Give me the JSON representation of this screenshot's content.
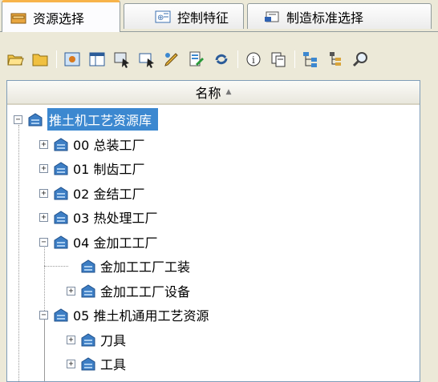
{
  "tabs": [
    {
      "label": "资源选择",
      "active": true
    },
    {
      "label": "控制特征",
      "active": false
    },
    {
      "label": "制造标准选择",
      "active": false
    }
  ],
  "toolbar": {
    "icons": [
      "open-folder-icon",
      "folder-icon",
      "image-icon",
      "window-icon",
      "zoom-select-icon",
      "select-cursor-icon",
      "edit-icon",
      "tree-edit-icon",
      "refresh-icon",
      "info-icon",
      "copy-icon",
      "hierarchy-icon",
      "tree-icon",
      "search-icon"
    ]
  },
  "tree": {
    "column_header": "名称",
    "sort_indicator": "▲",
    "nodes": [
      {
        "label": "推土机工艺资源库",
        "selected": true
      },
      {
        "label": "00 总装工厂"
      },
      {
        "label": "01 制齿工厂"
      },
      {
        "label": "02 金结工厂"
      },
      {
        "label": "03 热处理工厂"
      },
      {
        "label": "04 金加工工厂"
      },
      {
        "label": "金加工工厂工装"
      },
      {
        "label": "金加工工厂设备"
      },
      {
        "label": "05 推土机通用工艺资源"
      },
      {
        "label": "刀具"
      },
      {
        "label": "工具"
      }
    ]
  },
  "colors": {
    "selection": "#3c88d0",
    "node_icon": "#3d7ec4",
    "tab_accent": "#f7b34a"
  }
}
